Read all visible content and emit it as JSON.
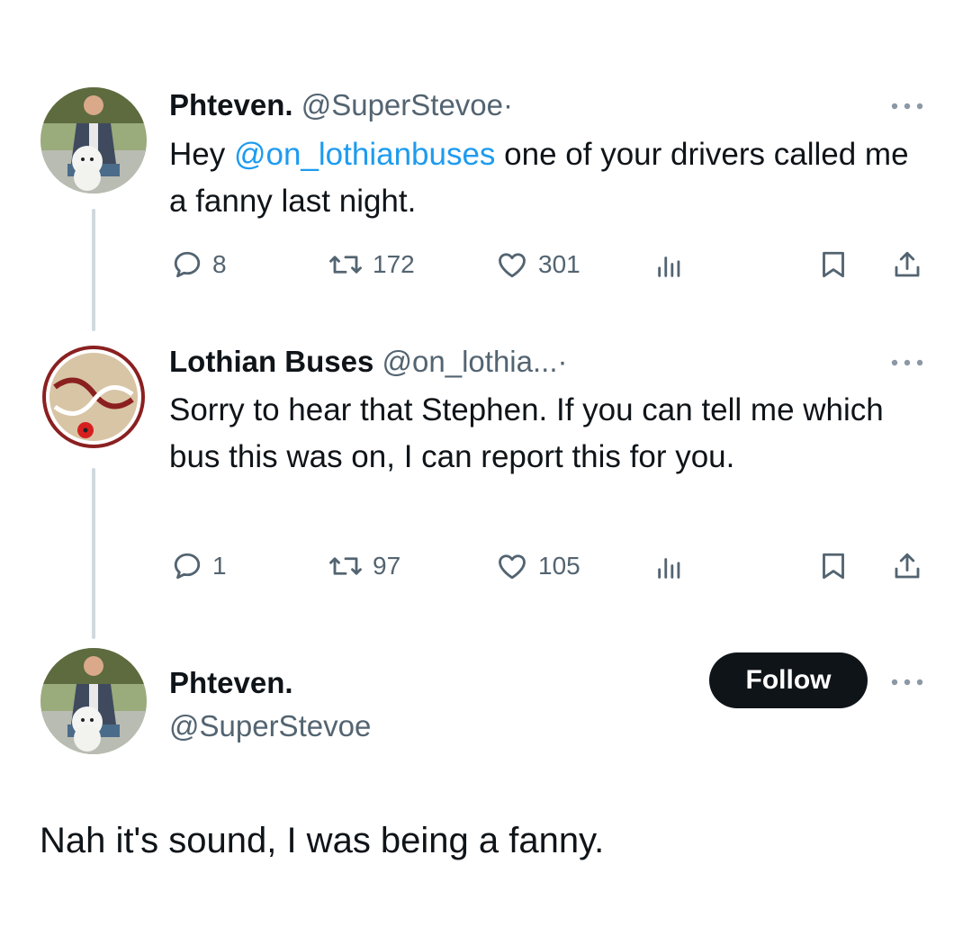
{
  "tweet1": {
    "name": "Phteven.",
    "handle": "@SuperStevoe",
    "sep": "·",
    "text_before": "Hey ",
    "mention": "@on_lothianbuses",
    "text_after": " one of your drivers called me a fanny last night.",
    "replies": "8",
    "retweets": "172",
    "likes": "301",
    "icons": [
      "avatar",
      "more-icon",
      "reply-icon",
      "retweet-icon",
      "like-icon",
      "views-icon",
      "bookmark-icon",
      "share-icon"
    ]
  },
  "tweet2": {
    "name": "Lothian Buses",
    "handle": "@on_lothia...",
    "sep": "·",
    "text": "Sorry to hear that Stephen. If you can tell me which bus this was on, I can report this for you.",
    "replies": "1",
    "retweets": "97",
    "likes": "105"
  },
  "tweet3": {
    "name": "Phteven.",
    "handle": "@SuperStevoe",
    "follow_label": "Follow",
    "text": "Nah it's sound, I was being a fanny."
  },
  "colors": {
    "accent": "#1d9bf0",
    "text": "#0f1419",
    "secondary": "#536471",
    "lothian_maroon": "#8b2020"
  }
}
